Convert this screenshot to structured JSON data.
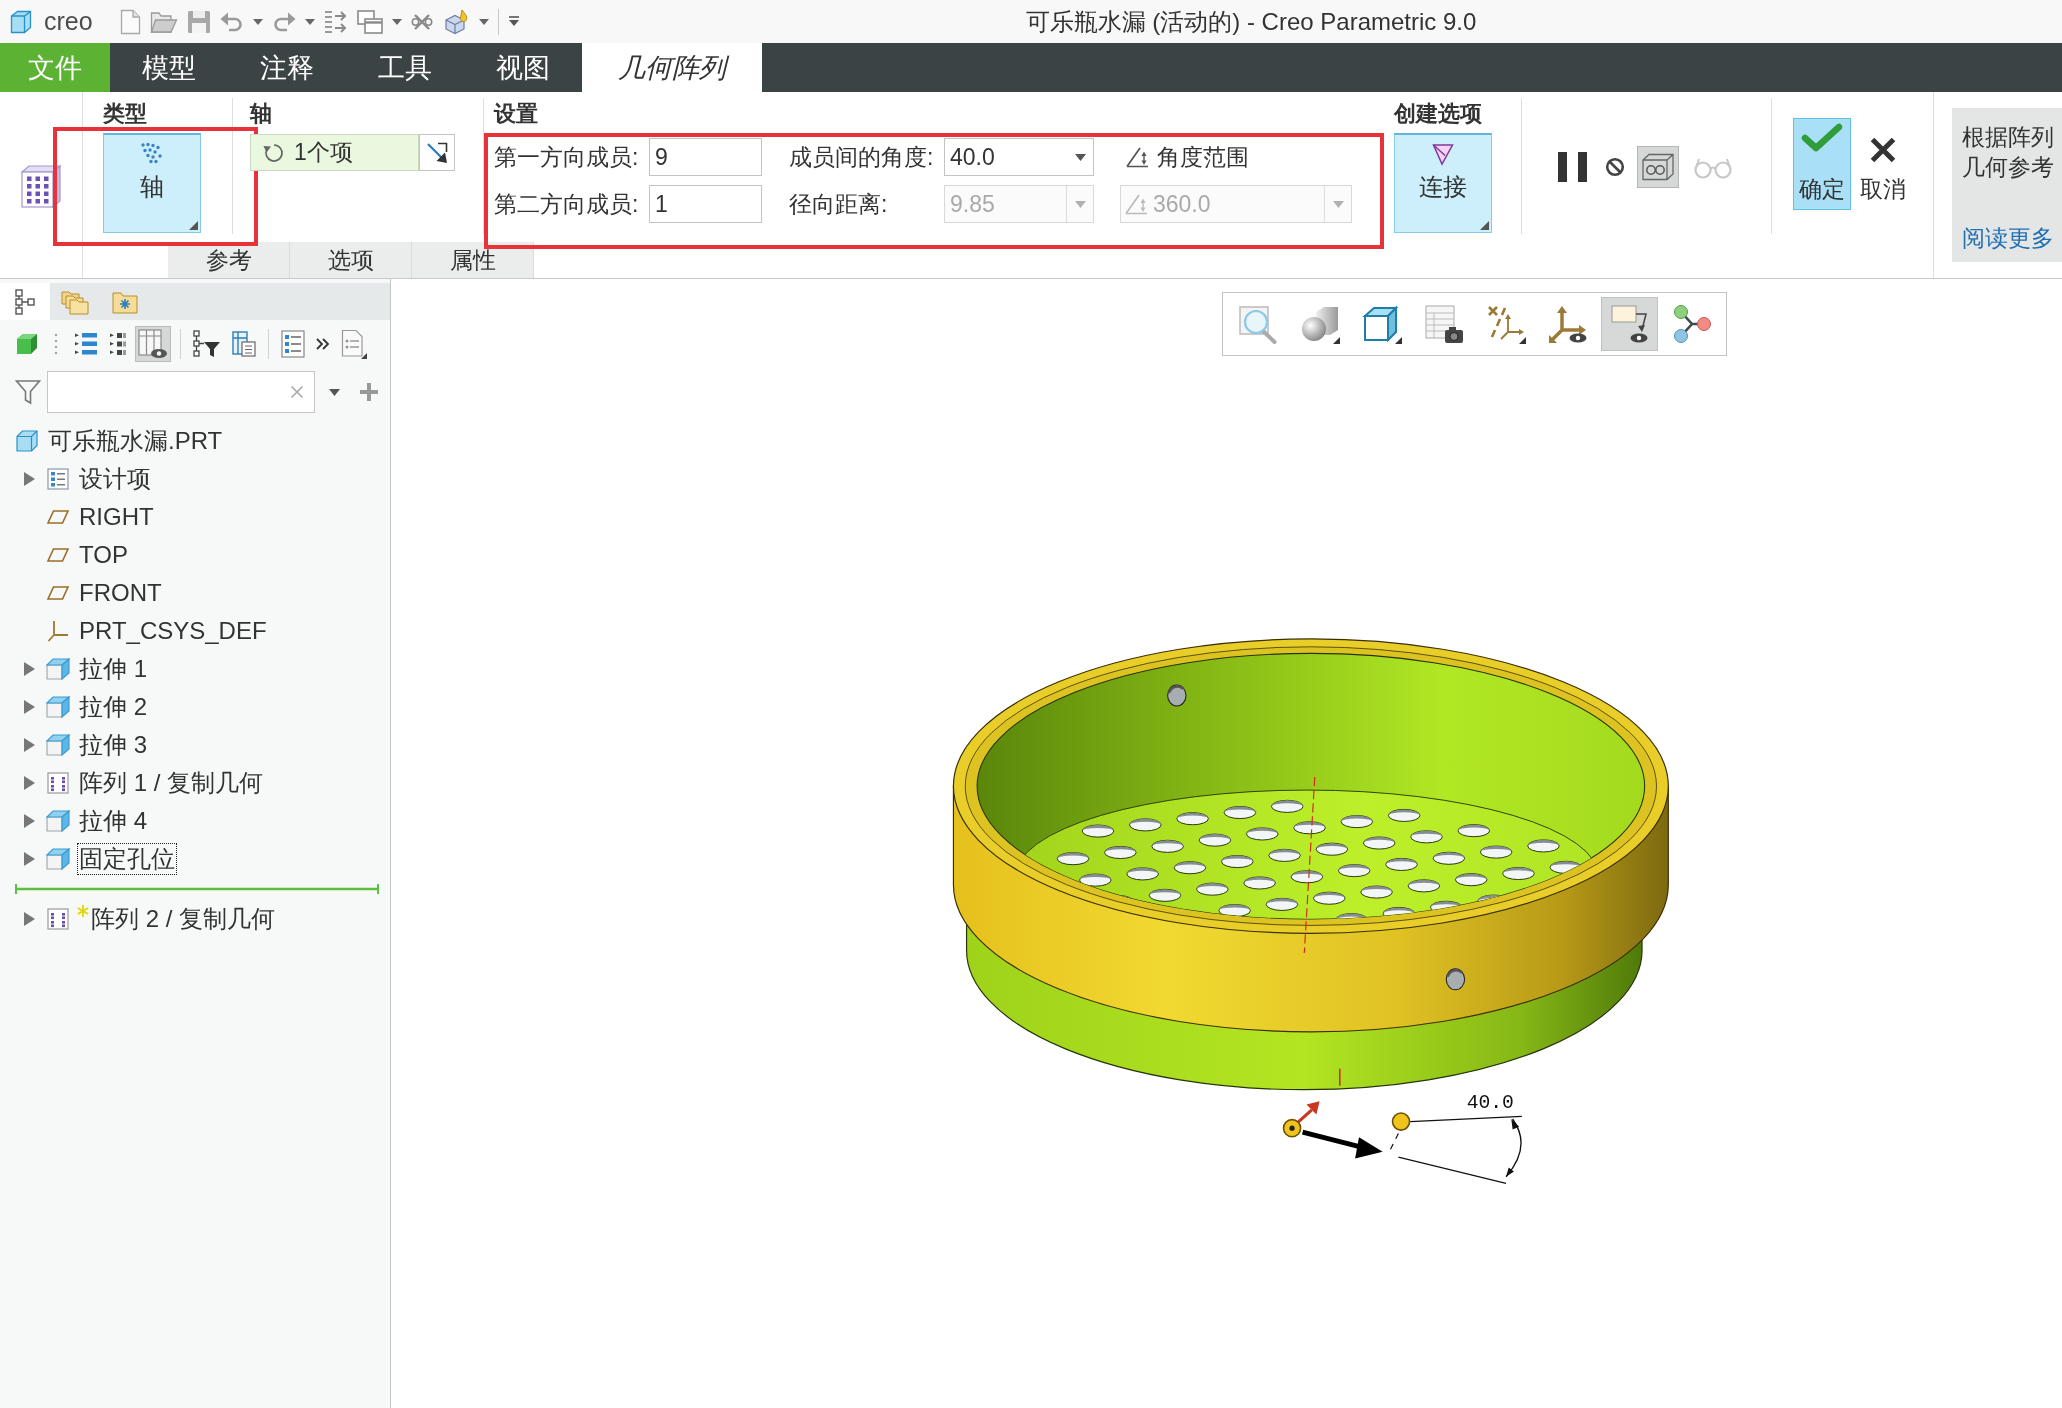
{
  "window": {
    "logo": "creo",
    "title": "可乐瓶水漏 (活动的) - Creo Parametric 9.0"
  },
  "menu_tabs": [
    {
      "label": "文件",
      "kind": "file",
      "selected": false
    },
    {
      "label": "模型",
      "kind": "tab",
      "selected": false
    },
    {
      "label": "注释",
      "kind": "tab",
      "selected": false
    },
    {
      "label": "工具",
      "kind": "tab",
      "selected": false
    },
    {
      "label": "视图",
      "kind": "tab",
      "selected": false
    },
    {
      "label": "几何阵列",
      "kind": "tab",
      "selected": true
    }
  ],
  "ribbon": {
    "type_group": {
      "title": "类型",
      "highlighted": true,
      "button": "轴"
    },
    "axis_group": {
      "title": "轴",
      "collector": "1个项"
    },
    "settings_group": {
      "title": "设置",
      "highlighted": true,
      "fields": [
        {
          "kind": "input",
          "label": "第一方向成员:",
          "value": "9",
          "disabled": false
        },
        {
          "kind": "dropdown",
          "label": "成员间的角度:",
          "value": "40.0",
          "disabled": false
        },
        {
          "kind": "toggle",
          "label": "角度范围",
          "on": false,
          "disabled": false
        },
        {
          "kind": "input",
          "label": "第二方向成员:",
          "value": "1",
          "disabled": false
        },
        {
          "kind": "dropdown",
          "label": "径向距离:",
          "value": "9.85",
          "disabled": true
        },
        {
          "kind": "angle-dropdown",
          "value": "360.0",
          "disabled": true
        }
      ]
    },
    "create_group": {
      "title": "创建选项",
      "button": "连接"
    },
    "tools": [
      {
        "kind": "pause",
        "on": false,
        "disabled": false
      },
      {
        "kind": "stop",
        "on": false,
        "disabled": false
      },
      {
        "kind": "preview",
        "on": true,
        "disabled": false
      },
      {
        "kind": "glasses",
        "on": false,
        "disabled": true
      }
    ],
    "actions": [
      {
        "kind": "ok",
        "label": "确定"
      },
      {
        "kind": "cancel",
        "label": "取消"
      }
    ],
    "help": {
      "lines": [
        "根据阵列",
        "几何参考"
      ],
      "link": "阅读更多"
    },
    "panel_tabs": [
      {
        "label": "参考",
        "selected": false
      },
      {
        "label": "选项",
        "selected": false
      },
      {
        "label": "属性",
        "selected": false
      }
    ]
  },
  "model_tree": {
    "tabs": [
      {
        "kind": "tree",
        "selected": true
      },
      {
        "kind": "folders",
        "selected": false
      },
      {
        "kind": "favorites",
        "selected": false
      }
    ],
    "toolbar": [
      [
        {
          "kind": "show",
          "on": false
        },
        {
          "kind": "grip"
        },
        {
          "kind": "expand",
          "on": false
        },
        {
          "kind": "collapse",
          "on": false
        },
        {
          "kind": "columns",
          "on": true
        }
      ],
      [
        {
          "kind": "tree-filter",
          "on": false
        },
        {
          "kind": "table",
          "on": false
        }
      ],
      [
        {
          "kind": "settings",
          "on": false
        },
        {
          "kind": "more",
          "on": false
        },
        {
          "kind": "notes",
          "on": false
        }
      ]
    ],
    "root": {
      "label": "可乐瓶水漏.PRT",
      "kind": "part",
      "children": [
        {
          "label": "设计项",
          "kind": "design-items",
          "expandable": true,
          "focused": false,
          "new": false
        },
        {
          "label": "RIGHT",
          "kind": "datum-plane",
          "expandable": false,
          "focused": false,
          "new": false
        },
        {
          "label": "TOP",
          "kind": "datum-plane",
          "expandable": false,
          "focused": false,
          "new": false
        },
        {
          "label": "FRONT",
          "kind": "datum-plane",
          "expandable": false,
          "focused": false,
          "new": false
        },
        {
          "label": "PRT_CSYS_DEF",
          "kind": "csys",
          "expandable": false,
          "focused": false,
          "new": false
        },
        {
          "label": "拉伸 1",
          "kind": "extrude",
          "expandable": true,
          "focused": false,
          "new": false
        },
        {
          "label": "拉伸 2",
          "kind": "extrude",
          "expandable": true,
          "focused": false,
          "new": false
        },
        {
          "label": "拉伸 3",
          "kind": "extrude",
          "expandable": true,
          "focused": false,
          "new": false
        },
        {
          "label": "阵列 1 / 复制几何",
          "kind": "pattern",
          "expandable": true,
          "focused": false,
          "new": false
        },
        {
          "label": "拉伸 4",
          "kind": "extrude",
          "expandable": true,
          "focused": false,
          "new": false
        },
        {
          "label": "固定孔位",
          "kind": "extrude",
          "expandable": true,
          "focused": true,
          "new": false
        },
        {
          "kind": "insert-marker"
        },
        {
          "label": "阵列 2 / 复制几何",
          "kind": "pattern",
          "expandable": true,
          "focused": false,
          "new": true
        }
      ]
    }
  },
  "viewport": {
    "toolbar": [
      {
        "kind": "zoom",
        "on": false
      },
      {
        "kind": "appearance",
        "on": false
      },
      {
        "kind": "view",
        "on": false
      },
      {
        "kind": "snapshot",
        "on": false
      },
      {
        "kind": "datum",
        "on": false
      },
      {
        "kind": "csys",
        "on": false
      },
      {
        "kind": "annotation",
        "on": true
      },
      {
        "kind": "nodes",
        "on": false
      }
    ],
    "dimension": "40.0"
  }
}
